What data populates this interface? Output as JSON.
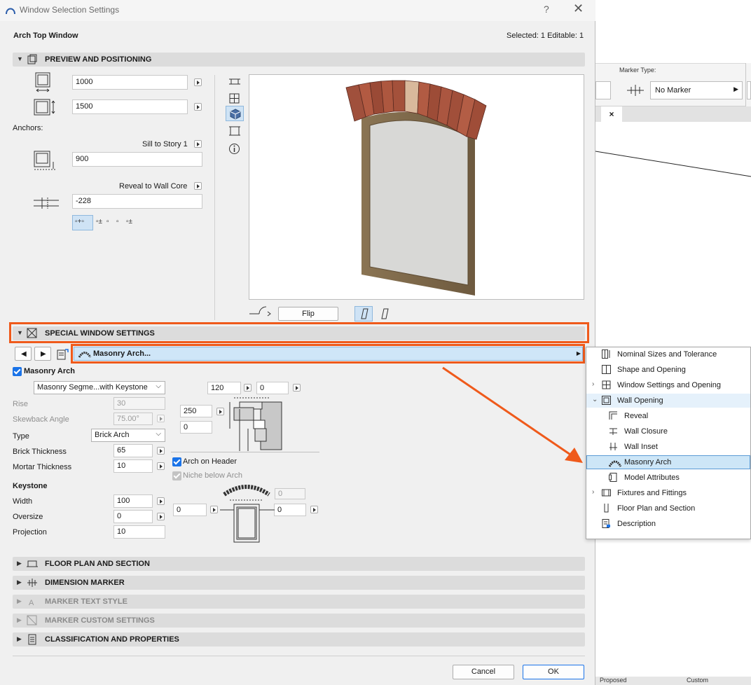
{
  "window": {
    "title": "Window Selection Settings",
    "help": "?",
    "close": "✕",
    "object_name": "Arch Top Window",
    "selection_info": "Selected: 1 Editable: 1"
  },
  "sections": {
    "preview": "PREVIEW AND POSITIONING",
    "special": "SPECIAL WINDOW SETTINGS",
    "floor_plan": "FLOOR PLAN AND SECTION",
    "dimension_marker": "DIMENSION MARKER",
    "marker_text": "MARKER TEXT STYLE",
    "marker_custom": "MARKER CUSTOM SETTINGS",
    "classification": "CLASSIFICATION AND PROPERTIES"
  },
  "preview": {
    "width": "1000",
    "height": "1500",
    "anchors_label": "Anchors:",
    "sill_anchor": "Sill to Story 1",
    "sill_value": "900",
    "reveal_anchor": "Reveal to Wall Core",
    "reveal_value": "-228",
    "flip": "Flip"
  },
  "special": {
    "page": "Masonry Arch...",
    "masonry_arch_checkbox": "Masonry Arch",
    "arch_type": "Masonry Segme...with Keystone",
    "rise_label": "Rise",
    "rise_value": "30",
    "skewback_label": "Skewback Angle",
    "skewback_value": "75.00°",
    "type_label": "Type",
    "type_value": "Brick Arch",
    "brick_label": "Brick Thickness",
    "brick_value": "65",
    "mortar_label": "Mortar Thickness",
    "mortar_value": "10",
    "keystone_heading": "Keystone",
    "ks_width_label": "Width",
    "ks_width_value": "100",
    "ks_oversize_label": "Oversize",
    "ks_oversize_value": "0",
    "ks_projection_label": "Projection",
    "ks_projection_value": "10",
    "dim_top_a": "120",
    "dim_top_b": "0",
    "dim_side": "250",
    "dim_side_b": "0",
    "arch_on_header": "Arch on Header",
    "niche_below_arch": "Niche below Arch",
    "niche_top": "0",
    "niche_left": "0",
    "niche_right": "0"
  },
  "tree": {
    "items": [
      {
        "label": "Nominal Sizes and Tolerance"
      },
      {
        "label": "Shape and Opening"
      },
      {
        "label": "Window Settings and Opening"
      },
      {
        "label": "Wall Opening"
      },
      {
        "label": "Reveal"
      },
      {
        "label": "Wall Closure"
      },
      {
        "label": "Wall Inset"
      },
      {
        "label": "Masonry Arch"
      },
      {
        "label": "Model Attributes"
      },
      {
        "label": "Fixtures and Fittings"
      },
      {
        "label": "Floor Plan and Section"
      },
      {
        "label": "Description"
      }
    ]
  },
  "buttons": {
    "cancel": "Cancel",
    "ok": "OK"
  },
  "background": {
    "marker_type_label": "Marker Type:",
    "marker_type_value": "No Marker",
    "tab_close": "×",
    "status_left": "Proposed",
    "status_right": "Custom"
  },
  "colors": {
    "highlight": "#ef5a1b",
    "accent": "#1a73e8",
    "selected_row": "#cde6f7"
  }
}
